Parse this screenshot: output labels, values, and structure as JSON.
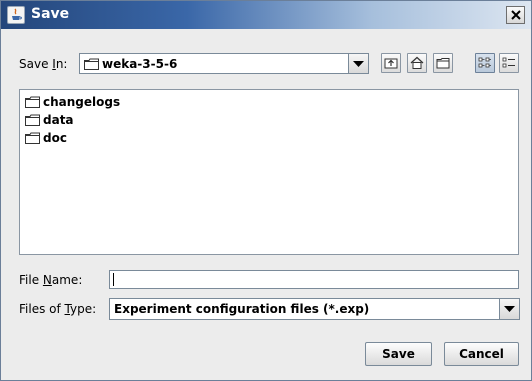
{
  "window": {
    "title": "Save",
    "app_icon": "java-cup-icon",
    "close_icon": "close-icon"
  },
  "save_in": {
    "label_before": "Save ",
    "label_mnemonic": "I",
    "label_after": "n:",
    "selected_value": "weka-3-5-6",
    "folder_icon": "folder-icon",
    "dropdown_icon": "chevron-down-icon"
  },
  "toolbar": {
    "buttons": [
      {
        "name": "up-one-level",
        "icon": "up-folder-icon"
      },
      {
        "name": "home",
        "icon": "home-icon"
      },
      {
        "name": "create-new-folder",
        "icon": "new-folder-icon"
      },
      {
        "name": "list-view",
        "icon": "list-view-icon",
        "active": true
      },
      {
        "name": "details-view",
        "icon": "details-view-icon",
        "active": false
      }
    ]
  },
  "files": [
    {
      "name": "changelogs",
      "icon": "folder-icon"
    },
    {
      "name": "data",
      "icon": "folder-icon"
    },
    {
      "name": "doc",
      "icon": "folder-icon"
    }
  ],
  "file_name": {
    "label_before": "File ",
    "label_mnemonic": "N",
    "label_after": "ame:",
    "value": ""
  },
  "files_of_type": {
    "label_before": "Files of ",
    "label_mnemonic": "T",
    "label_after": "ype:",
    "selected_value": "Experiment configuration files (*.exp)"
  },
  "buttons": {
    "save": "Save",
    "cancel": "Cancel"
  },
  "colors": {
    "title_bar_start": "#24467b",
    "title_bar_end": "#dde6f1",
    "dialog_background": "#ececec"
  }
}
